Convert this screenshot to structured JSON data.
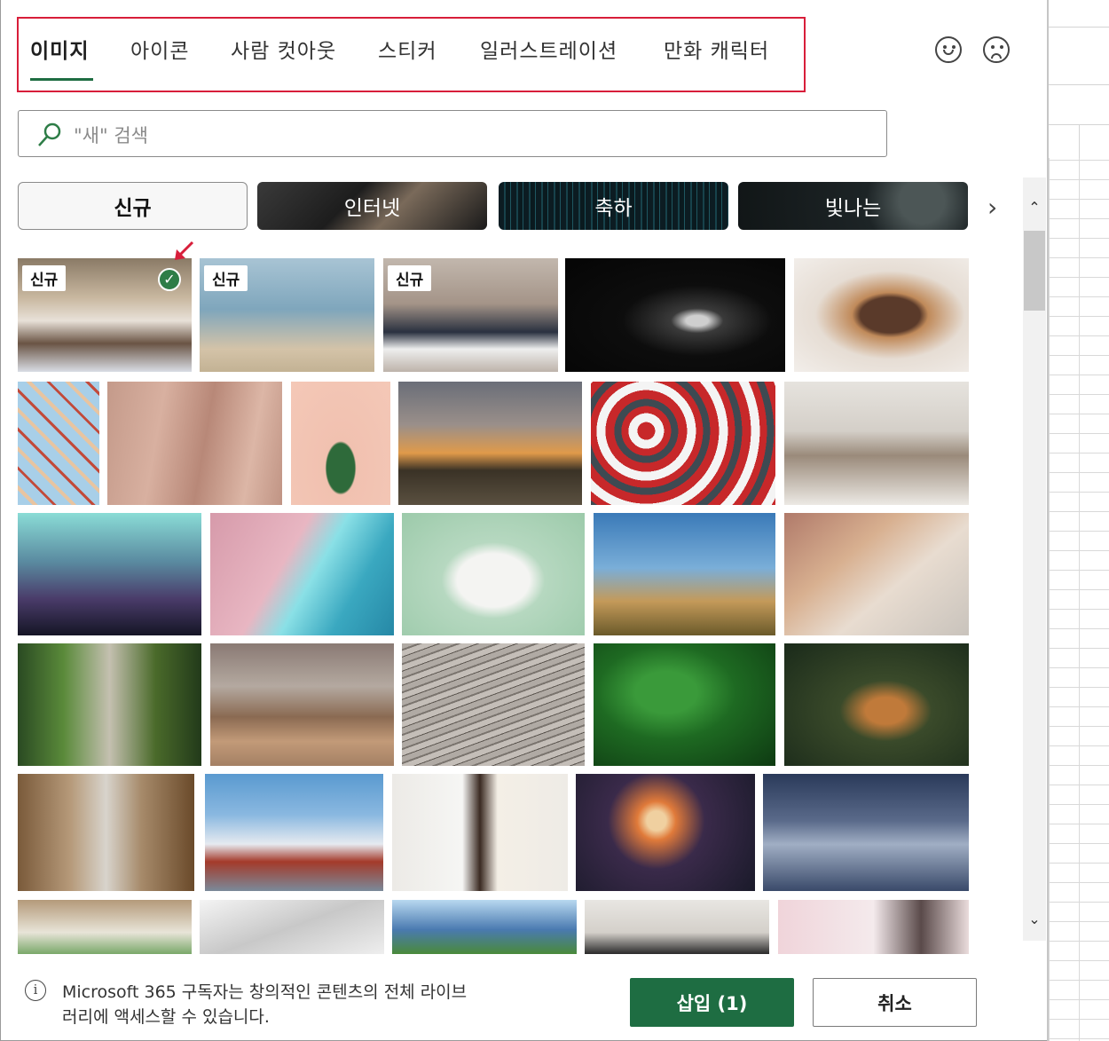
{
  "tabs": [
    {
      "label": "이미지",
      "active": true
    },
    {
      "label": "아이콘",
      "active": false
    },
    {
      "label": "사람 컷아웃",
      "active": false
    },
    {
      "label": "스티커",
      "active": false
    },
    {
      "label": "일러스트레이션",
      "active": false
    },
    {
      "label": "만화 캐릭터",
      "active": false
    }
  ],
  "search": {
    "placeholder": "\"새\" 검색"
  },
  "categories": [
    {
      "label": "신규"
    },
    {
      "label": "인터넷"
    },
    {
      "label": "축하"
    },
    {
      "label": "빛나는"
    }
  ],
  "badge_label": "신규",
  "footer": {
    "info_icon": "i",
    "text": "Microsoft 365 구독자는 창의적인 콘텐츠의 전체 라이브러리에 액세스할 수 있습니다.",
    "insert_label": "삽입 (1)",
    "cancel_label": "취소"
  },
  "colors": {
    "accent": "#1e6d42",
    "highlight": "#d81e3a"
  }
}
